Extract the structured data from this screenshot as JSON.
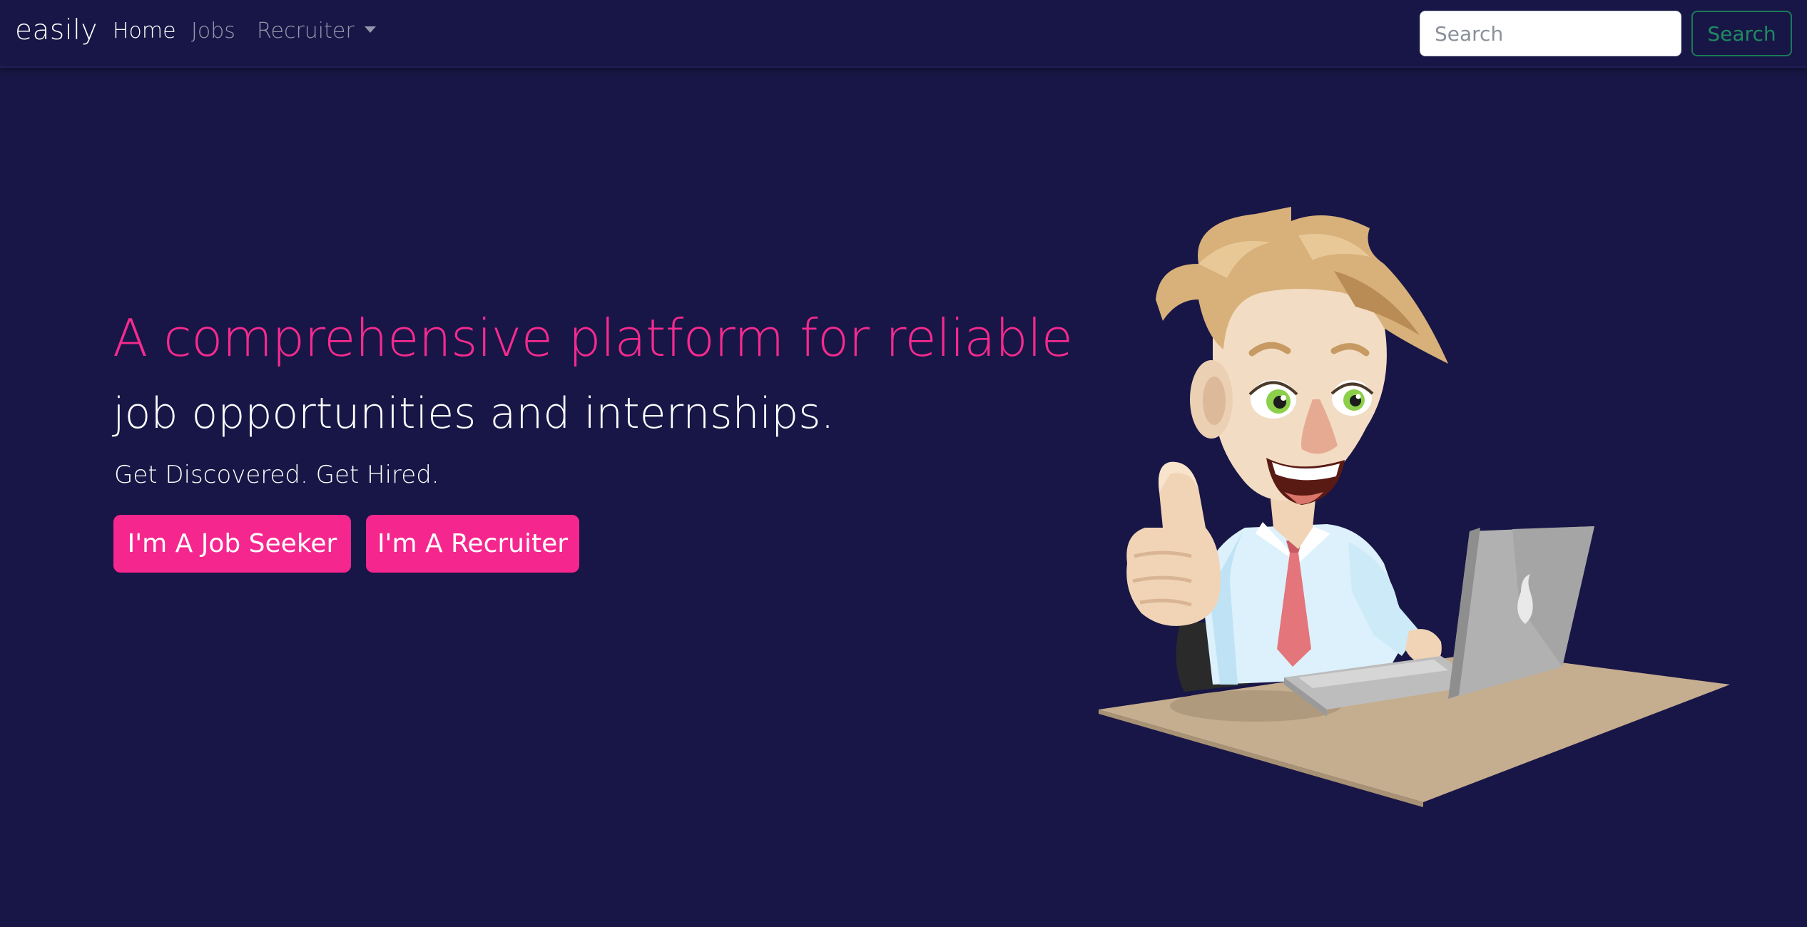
{
  "navbar": {
    "brand": "easily",
    "links": [
      {
        "label": "Home",
        "active": true
      },
      {
        "label": "Jobs",
        "active": false
      },
      {
        "label": "Recruiter",
        "active": false,
        "dropdown": true
      }
    ],
    "search": {
      "placeholder": "Search",
      "button_label": "Search"
    }
  },
  "hero": {
    "title": "A comprehensive platform for reliable",
    "subtitle": "job opportunities and internships.",
    "tagline": "Get Discovered. Get Hired.",
    "buttons": {
      "job_seeker": "I'm A Job Seeker",
      "recruiter": "I'm A Recruiter"
    },
    "illustration_icon": "thumbs-up-man-with-laptop-illustration"
  },
  "colors": {
    "background": "#181646",
    "accent": "#f5278e",
    "search_button": "#1e8a63"
  }
}
